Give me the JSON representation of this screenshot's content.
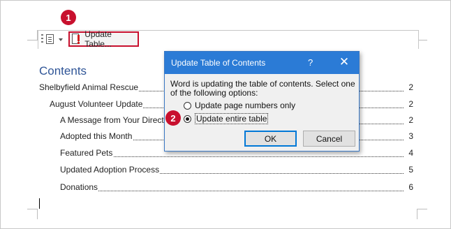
{
  "toolbar": {
    "update_table_label": "Update Table..."
  },
  "badges": {
    "first": "1",
    "second": "2"
  },
  "document": {
    "contents_title": "Contents",
    "toc": [
      {
        "label": "Shelbyfield Animal Rescue",
        "page": "2"
      },
      {
        "label": "August Volunteer Update",
        "page": "2"
      },
      {
        "label": "A Message from Your Director",
        "page": "2"
      },
      {
        "label": "Adopted this Month",
        "page": "3"
      },
      {
        "label": "Featured Pets",
        "page": "4"
      },
      {
        "label": "Updated Adoption Process",
        "page": "5"
      },
      {
        "label": "Donations",
        "page": "6"
      }
    ]
  },
  "dialog": {
    "title": "Update Table of Contents",
    "help_label": "?",
    "close_label": "✕",
    "message": "Word is updating the table of contents.  Select one of the following options:",
    "option_page_numbers": "Update page numbers only",
    "option_entire_table": "Update entire table",
    "selected_option": "Update entire table",
    "ok_label": "OK",
    "cancel_label": "Cancel"
  },
  "colors": {
    "accent": "#2b7bd6",
    "callout": "#c8102e",
    "heading": "#2f5597"
  }
}
